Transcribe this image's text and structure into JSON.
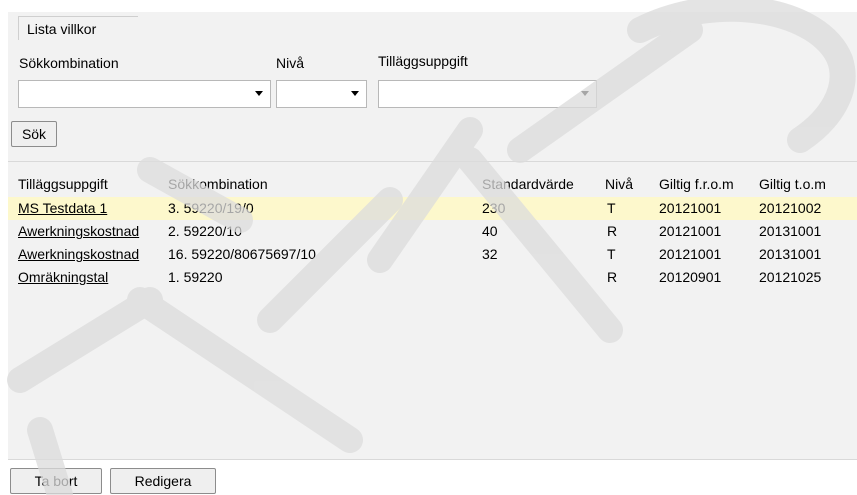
{
  "filter": {
    "legend": "Lista villkor",
    "search_combination_label": "Sökkombination",
    "level_label": "Nivå",
    "supplement_label": "Tilläggsuppgift",
    "search_combination_value": "",
    "level_value": "",
    "supplement_value": "",
    "search_button": "Sök"
  },
  "table": {
    "columns": [
      "Tilläggsuppgift",
      "Sökkombination",
      "Standardvärde",
      "Nivå",
      "Giltig f.r.o.m",
      "Giltig t.o.m"
    ],
    "rows": [
      {
        "supplement": "MS Testdata 1",
        "combination": "3. 59220/19/0",
        "standard": "230",
        "level": "T",
        "from": "20121001",
        "to": "20121002",
        "selected": true
      },
      {
        "supplement": "Awerkningskostnad",
        "combination": "2. 59220/10",
        "standard": "40",
        "level": "R",
        "from": "20121001",
        "to": "20131001",
        "selected": false
      },
      {
        "supplement": "Awerkningskostnad",
        "combination": "16. 59220/80675697/10",
        "standard": "32",
        "level": "T",
        "from": "20121001",
        "to": "20131001",
        "selected": false
      },
      {
        "supplement": "Omräkningstal",
        "combination": "1. 59220",
        "standard": "",
        "level": "R",
        "from": "20120901",
        "to": "20121025",
        "selected": false
      }
    ]
  },
  "actions": {
    "delete_button": "Ta bort",
    "edit_button": "Redigera"
  },
  "colors": {
    "panel_bg": "#f2f2f2",
    "selected_row": "#fdf8cc",
    "watermark": "#dcdcdc"
  }
}
